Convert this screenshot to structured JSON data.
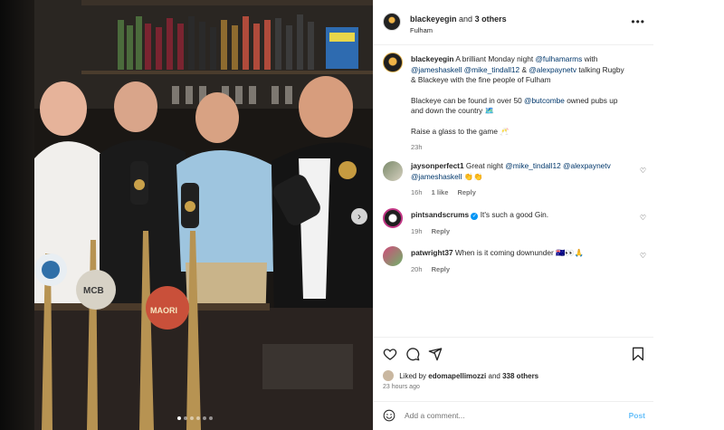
{
  "post": {
    "header": {
      "username": "blackeyegin",
      "and_text": "and",
      "others": "3 others",
      "location": "Fulham",
      "more_icon": "more-horizontal-icon"
    },
    "caption": {
      "username": "blackeyegin",
      "text_1": "A brilliant Monday night",
      "mention_1": "@fulhamarms",
      "text_2": "with",
      "mention_2": "@jameshaskell",
      "mention_3": "@mike_tindall12",
      "amp": "&",
      "mention_4": "@alexpaynetv",
      "text_3": "talking Rugby & Blackeye with the fine people of Fulham",
      "p2_text_1": "Blackeye can be found in over 50",
      "p2_mention": "@butcombe",
      "p2_text_2": "owned pubs up and down the country",
      "p2_emoji": "🗺️",
      "p3_text": "Raise a glass to the game",
      "p3_emoji": "🥂",
      "time": "23h"
    },
    "comments": [
      {
        "username": "jaysonperfect1",
        "text": "Great night",
        "mention_1": "@mike_tindall12",
        "mention_2": "@alexpaynetv",
        "mention_3": "@jameshaskell",
        "emoji": "👏👏",
        "time": "16h",
        "likes": "1 like",
        "reply": "Reply"
      },
      {
        "username": "pintsandscrums",
        "verified": "✓",
        "text": "It's such a good Gin.",
        "time": "19h",
        "reply": "Reply"
      },
      {
        "username": "patwright37",
        "text": "When is it coming downunder",
        "emoji": "🇦🇺👀🙏",
        "time": "20h",
        "reply": "Reply"
      }
    ],
    "actions": {
      "like_icon": "heart-icon",
      "comment_icon": "comment-icon",
      "share_icon": "share-icon",
      "save_icon": "bookmark-icon"
    },
    "liked_by": {
      "prefix": "Liked by",
      "user": "edomapellimozzi",
      "and": "and",
      "count": "338 others"
    },
    "posted_ago": "23 hours ago",
    "add_comment": {
      "placeholder": "Add a comment...",
      "post_label": "Post",
      "emoji_icon": "smiley-icon"
    }
  },
  "carousel": {
    "next_icon": "chevron-right-icon",
    "dots_total": 6,
    "dots_active": 1
  }
}
